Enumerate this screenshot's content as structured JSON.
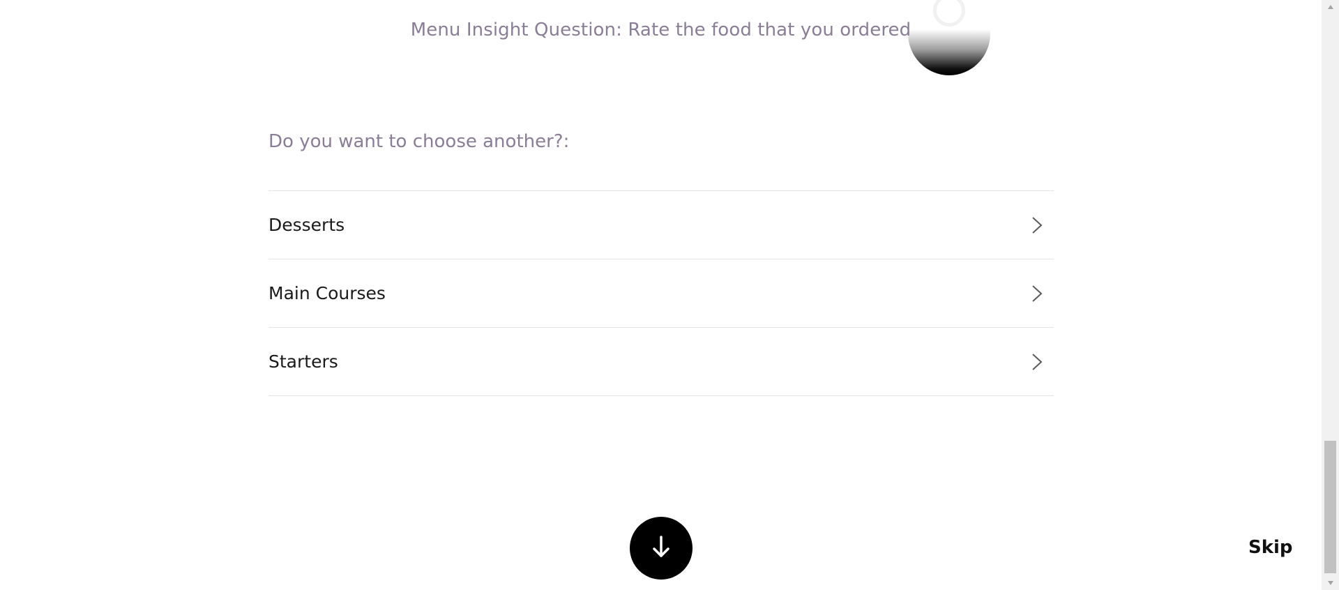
{
  "header": {
    "question": "Menu Insight Question: Rate the food that you ordered"
  },
  "prompt": {
    "label": "Do you want to choose another?:"
  },
  "categories": [
    {
      "label": "Desserts",
      "icon": "chevron-right-icon"
    },
    {
      "label": "Main Courses",
      "icon": "chevron-right-icon"
    },
    {
      "label": "Starters",
      "icon": "chevron-right-icon"
    }
  ],
  "footer": {
    "next_icon": "arrow-down-icon",
    "skip_label": "Skip"
  },
  "colors": {
    "accent_text": "#8a7d98",
    "primary": "#000000",
    "divider": "#e3e3e3"
  },
  "scrollbar": {
    "position": "bottom"
  }
}
